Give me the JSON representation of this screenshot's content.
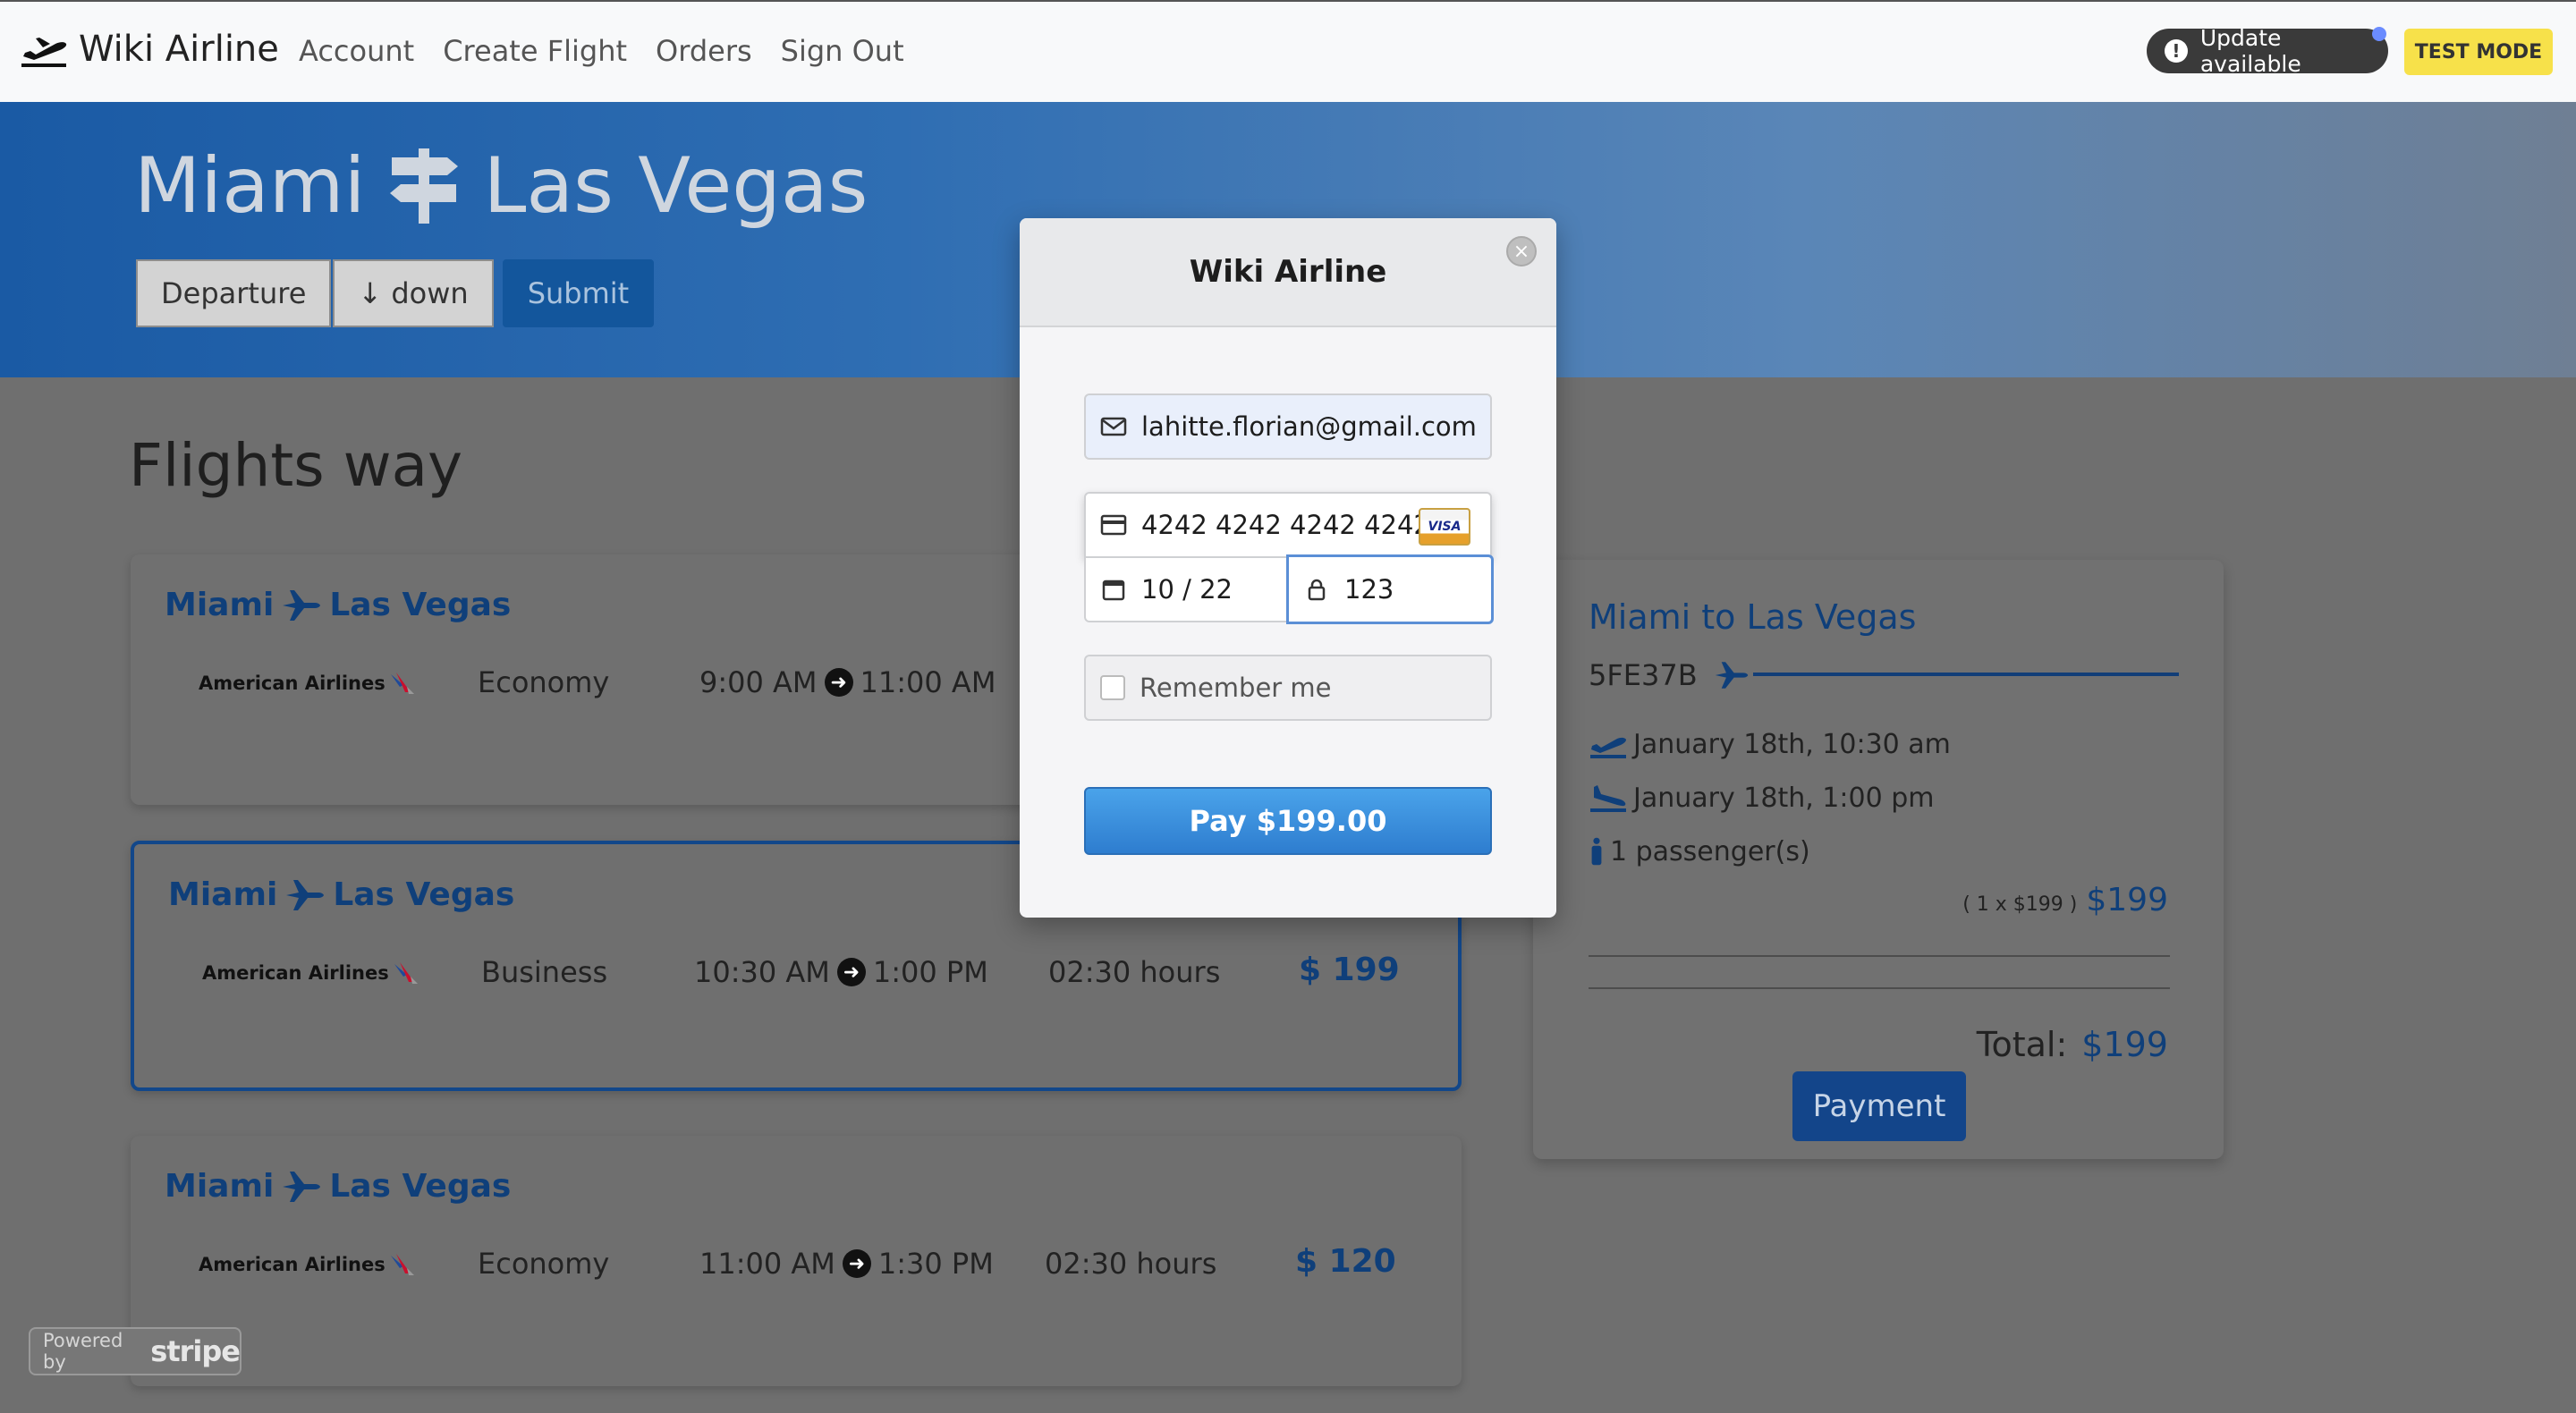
{
  "navbar": {
    "brand": "Wiki Airline",
    "links": [
      "Account",
      "Create Flight",
      "Orders",
      "Sign Out"
    ],
    "update_label": "Update available",
    "test_mode": "TEST MODE"
  },
  "hero": {
    "from": "Miami",
    "to": "Las Vegas",
    "buttons": {
      "departure": "Departure",
      "down": "↓ down",
      "submit": "Submit"
    }
  },
  "section_title": "Flights way",
  "flights": [
    {
      "route_from": "Miami",
      "route_to": "Las Vegas",
      "airline": "American Airlines",
      "cabin": "Economy",
      "depart": "9:00 AM",
      "arrive": "11:00 AM",
      "duration": "",
      "price": ""
    },
    {
      "route_from": "Miami",
      "route_to": "Las Vegas",
      "airline": "American Airlines",
      "cabin": "Business",
      "depart": "10:30 AM",
      "arrive": "1:00 PM",
      "duration": "02:30 hours",
      "price": "$ 199"
    },
    {
      "route_from": "Miami",
      "route_to": "Las Vegas",
      "airline": "American Airlines",
      "cabin": "Economy",
      "depart": "11:00 AM",
      "arrive": "1:30 PM",
      "duration": "02:30 hours",
      "price": "$ 120"
    }
  ],
  "summary": {
    "title": "Miami to Las Vegas",
    "code": "5FE37B",
    "departure": "January 18th, 10:30 am",
    "arrival": "January 18th, 1:00 pm",
    "passengers": "1 passenger(s)",
    "calc": "( 1 x $199 )",
    "subtotal": "$199",
    "total_label": "Total:",
    "total": "$199",
    "payment_button": "Payment"
  },
  "stripe": {
    "powered": "Powered by",
    "brand": "stripe"
  },
  "modal": {
    "title": "Wiki Airline",
    "close": "×",
    "email": "lahitte.florian@gmail.com",
    "card_number": "4242 4242 4242 4242",
    "card_brand": "VISA",
    "expiry": "10 / 22",
    "cvc": "123",
    "remember": "Remember me",
    "pay": "Pay $199.00"
  }
}
